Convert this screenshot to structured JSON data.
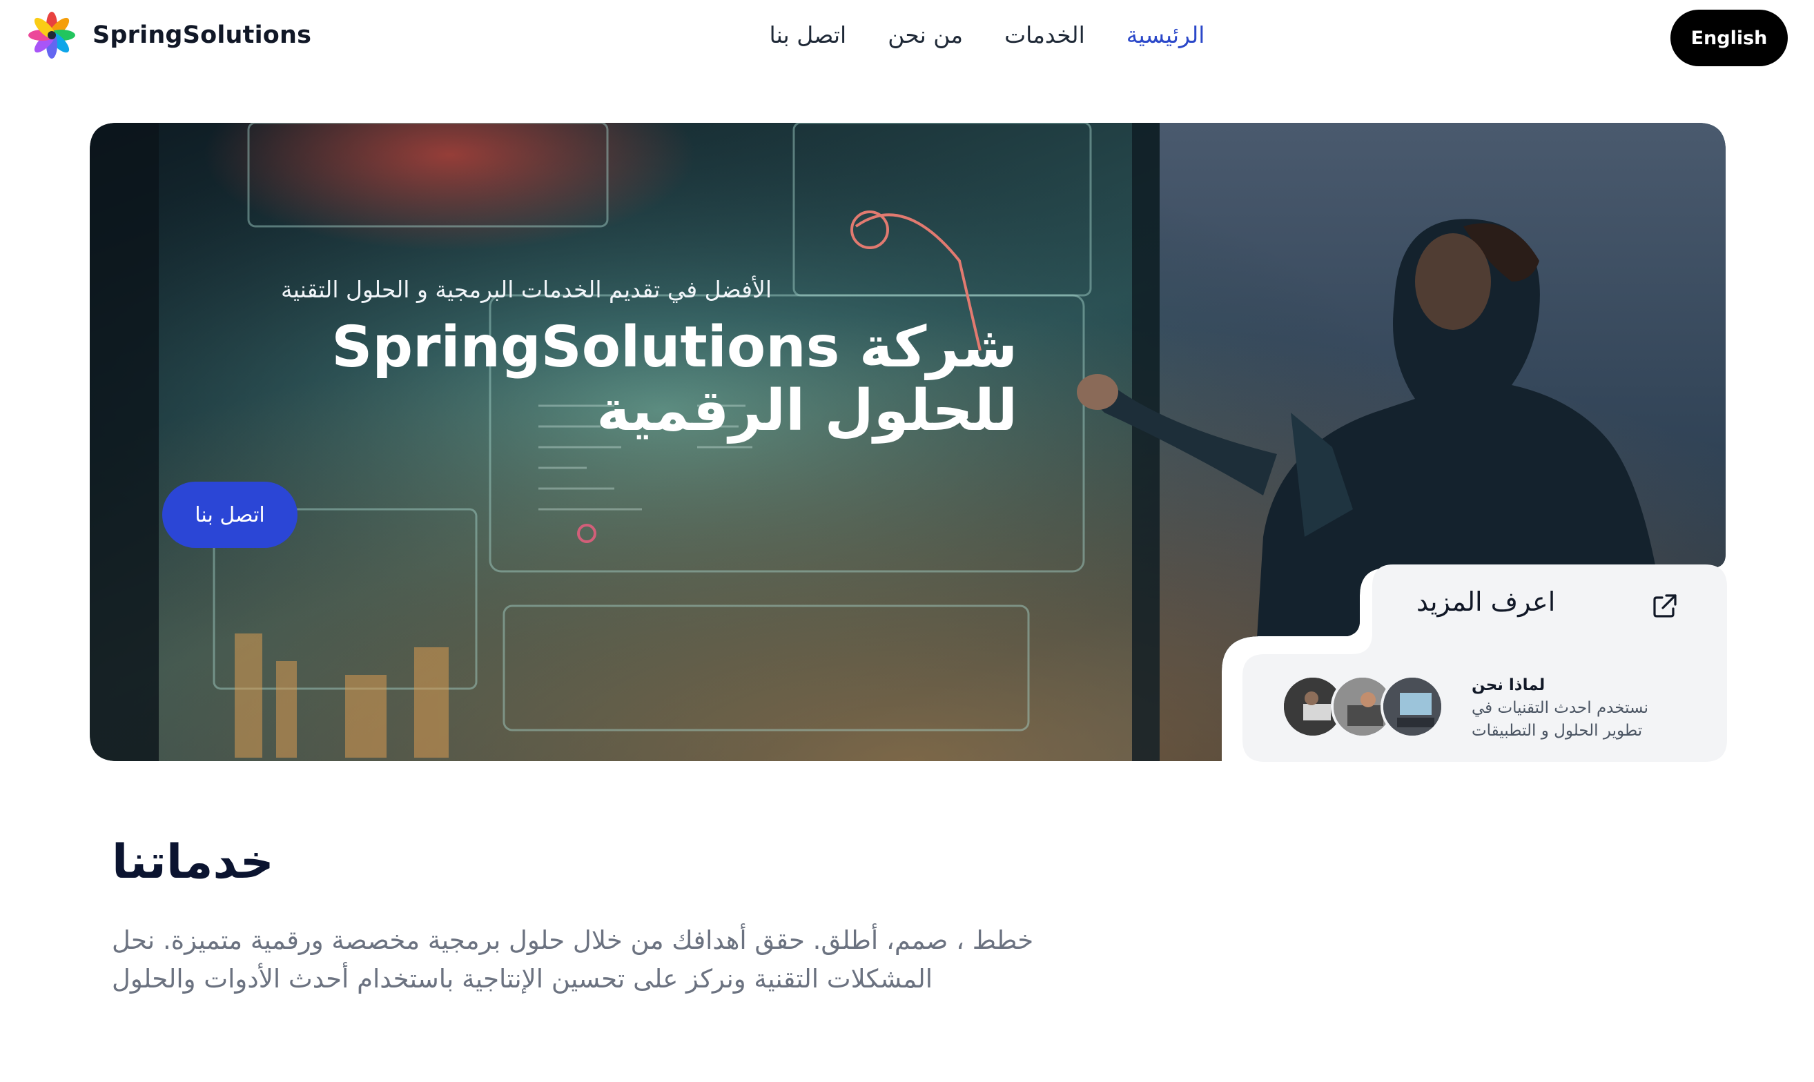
{
  "brand": {
    "name": "SpringSolutions",
    "logo_icon": "flower-logo-icon"
  },
  "nav": {
    "items": [
      {
        "label": "الرئيسية",
        "active": true
      },
      {
        "label": "الخدمات",
        "active": false
      },
      {
        "label": "من نحن",
        "active": false
      },
      {
        "label": "اتصل بنا",
        "active": false
      }
    ]
  },
  "lang_button": "English",
  "hero": {
    "subtitle": "الأفضل في تقديم الخدمات البرمجية و الحلول التقنية",
    "title": "شركة SpringSolutions للحلول الرقمية",
    "cta": "اتصل بنا"
  },
  "learn_more": {
    "title": "اعرف المزيد",
    "icon": "external-link-icon",
    "why_title": "لماذا نحن",
    "why_text": "نستخدم احدث التقنيات في تطوير الحلول و التطبيقات"
  },
  "services": {
    "title": "خدماتنا",
    "description": "خطط ، صمم، أطلق. حقق أهدافك من خلال حلول برمجية مخصصة ورقمية متميزة. نحل المشكلات التقنية ونركز على تحسين الإنتاجية باستخدام أحدث الأدوات والحلول"
  },
  "colors": {
    "accent": "#2b46d6",
    "nav_active": "#2b48c9",
    "card_bg": "#f3f4f6",
    "dark": "#000000"
  }
}
